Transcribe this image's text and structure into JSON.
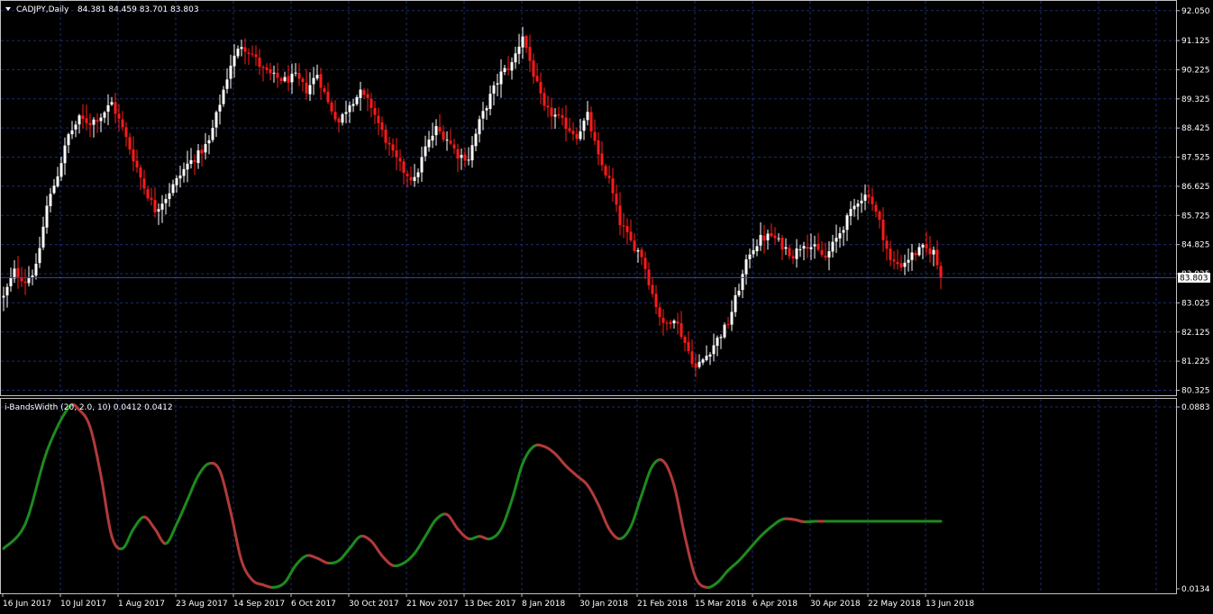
{
  "window": {
    "symbol_line": "CADJPY,Daily",
    "ohlc": "84.381 84.459 83.701 83.803",
    "indicator_line": "i-BandsWidth (20, 2.0, 10) 0.0412 0.0412"
  },
  "colors": {
    "background": "#000000",
    "grid": "#1c2d6b",
    "axis": "#c0c0c0",
    "bull": "#ffffff",
    "bear": "#ff1a1a",
    "bid_line": "#3a46a8",
    "indicator_up": "#1e8a1e",
    "indicator_down": "#b23a3a"
  },
  "icons": {
    "menu": "triangle-down-icon"
  },
  "chart_data": [
    {
      "type": "candlestick",
      "title": "CADJPY,Daily",
      "ylim": [
        80.2,
        92.1
      ],
      "current_price": 83.803,
      "current_price_label": "83.803",
      "price_ticks": [
        "92.050",
        "91.125",
        "90.225",
        "89.325",
        "88.425",
        "87.525",
        "86.625",
        "85.725",
        "84.825",
        "83.925",
        "83.025",
        "82.125",
        "81.225",
        "80.325"
      ],
      "date_ticks": [
        "16 Jun 2017",
        "10 Jul 2017",
        "1 Aug 2017",
        "23 Aug 2017",
        "14 Sep 2017",
        "6 Oct 2017",
        "30 Oct 2017",
        "21 Nov 2017",
        "13 Dec 2017",
        "8 Jan 2018",
        "30 Jan 2018",
        "21 Feb 2018",
        "15 Mar 2018",
        "6 Apr 2018",
        "30 Apr 2018",
        "22 May 2018",
        "13 Jun 2018"
      ],
      "close_path": [
        [
          0,
          83.2
        ],
        [
          3,
          84.0
        ],
        [
          6,
          83.7
        ],
        [
          9,
          84.1
        ],
        [
          12,
          86.0
        ],
        [
          15,
          87.0
        ],
        [
          18,
          88.2
        ],
        [
          21,
          88.7
        ],
        [
          24,
          88.6
        ],
        [
          27,
          88.8
        ],
        [
          30,
          89.2
        ],
        [
          33,
          88.4
        ],
        [
          36,
          87.5
        ],
        [
          39,
          86.6
        ],
        [
          42,
          85.9
        ],
        [
          45,
          86.3
        ],
        [
          48,
          86.8
        ],
        [
          51,
          87.3
        ],
        [
          54,
          87.6
        ],
        [
          57,
          88.0
        ],
        [
          60,
          89.2
        ],
        [
          63,
          90.4
        ],
        [
          66,
          91.0
        ],
        [
          69,
          90.7
        ],
        [
          72,
          90.2
        ],
        [
          75,
          90.0
        ],
        [
          78,
          89.9
        ],
        [
          81,
          90.0
        ],
        [
          84,
          89.6
        ],
        [
          87,
          90.1
        ],
        [
          90,
          89.2
        ],
        [
          93,
          88.6
        ],
        [
          96,
          89.2
        ],
        [
          99,
          89.5
        ],
        [
          102,
          89.1
        ],
        [
          105,
          88.3
        ],
        [
          108,
          87.6
        ],
        [
          111,
          87.1
        ],
        [
          114,
          86.8
        ],
        [
          117,
          87.8
        ],
        [
          120,
          88.4
        ],
        [
          123,
          88.1
        ],
        [
          126,
          87.6
        ],
        [
          129,
          87.5
        ],
        [
          132,
          88.6
        ],
        [
          135,
          89.4
        ],
        [
          138,
          90.1
        ],
        [
          141,
          90.4
        ],
        [
          144,
          91.3
        ],
        [
          147,
          90.1
        ],
        [
          150,
          89.0
        ],
        [
          153,
          88.8
        ],
        [
          156,
          88.5
        ],
        [
          159,
          88.2
        ],
        [
          162,
          88.8
        ],
        [
          165,
          87.5
        ],
        [
          168,
          86.8
        ],
        [
          171,
          85.5
        ],
        [
          174,
          84.9
        ],
        [
          177,
          84.5
        ],
        [
          180,
          83.3
        ],
        [
          183,
          82.3
        ],
        [
          186,
          82.6
        ],
        [
          189,
          81.8
        ],
        [
          192,
          81.0
        ],
        [
          195,
          81.4
        ],
        [
          198,
          81.9
        ],
        [
          201,
          82.4
        ],
        [
          204,
          83.5
        ],
        [
          207,
          84.6
        ],
        [
          210,
          85.0
        ],
        [
          213,
          85.1
        ],
        [
          216,
          84.8
        ],
        [
          219,
          84.5
        ],
        [
          222,
          84.9
        ],
        [
          225,
          84.7
        ],
        [
          228,
          84.4
        ],
        [
          231,
          85.0
        ],
        [
          234,
          85.6
        ],
        [
          237,
          86.2
        ],
        [
          240,
          86.4
        ],
        [
          243,
          85.5
        ],
        [
          246,
          84.3
        ],
        [
          249,
          84.2
        ],
        [
          252,
          84.5
        ],
        [
          255,
          84.7
        ],
        [
          258,
          84.6
        ],
        [
          260,
          83.8
        ]
      ]
    },
    {
      "type": "line",
      "title": "i-BandsWidth (20, 2.0, 10) 0.0412 0.0412",
      "ylim": [
        0.0134,
        0.0883
      ],
      "y_ticks": [
        "0.0883",
        "0.0134"
      ],
      "last_value": 0.0412,
      "x": [
        0,
        6,
        12,
        18,
        21,
        24,
        27,
        30,
        33,
        36,
        39,
        42,
        45,
        48,
        51,
        54,
        57,
        60,
        63,
        66,
        69,
        72,
        75,
        78,
        81,
        84,
        87,
        90,
        93,
        96,
        99,
        102,
        105,
        108,
        111,
        114,
        117,
        120,
        123,
        126,
        129,
        132,
        135,
        138,
        141,
        144,
        147,
        150,
        153,
        156,
        159,
        162,
        165,
        168,
        171,
        174,
        177,
        180,
        183,
        186,
        189,
        192,
        195,
        198,
        201,
        204,
        207,
        210,
        213,
        216,
        219,
        222,
        225,
        228,
        231,
        234,
        237,
        240,
        243,
        246,
        249,
        252,
        255,
        258,
        260
      ],
      "values": [
        0.03,
        0.04,
        0.07,
        0.088,
        0.087,
        0.08,
        0.06,
        0.035,
        0.03,
        0.038,
        0.043,
        0.038,
        0.032,
        0.04,
        0.05,
        0.06,
        0.065,
        0.062,
        0.045,
        0.025,
        0.017,
        0.015,
        0.014,
        0.016,
        0.023,
        0.027,
        0.026,
        0.024,
        0.025,
        0.03,
        0.035,
        0.033,
        0.027,
        0.023,
        0.024,
        0.028,
        0.035,
        0.042,
        0.044,
        0.038,
        0.034,
        0.035,
        0.034,
        0.038,
        0.05,
        0.065,
        0.072,
        0.072,
        0.069,
        0.064,
        0.06,
        0.056,
        0.048,
        0.038,
        0.034,
        0.039,
        0.052,
        0.064,
        0.066,
        0.056,
        0.035,
        0.018,
        0.014,
        0.016,
        0.021,
        0.025,
        0.03,
        0.035,
        0.039,
        0.042,
        0.042,
        0.041,
        0.0412,
        0.0412,
        0.0412,
        0.0412,
        0.0412,
        0.0412,
        0.0412,
        0.0412,
        0.0412,
        0.0412,
        0.0412,
        0.0412,
        0.0412
      ]
    }
  ]
}
